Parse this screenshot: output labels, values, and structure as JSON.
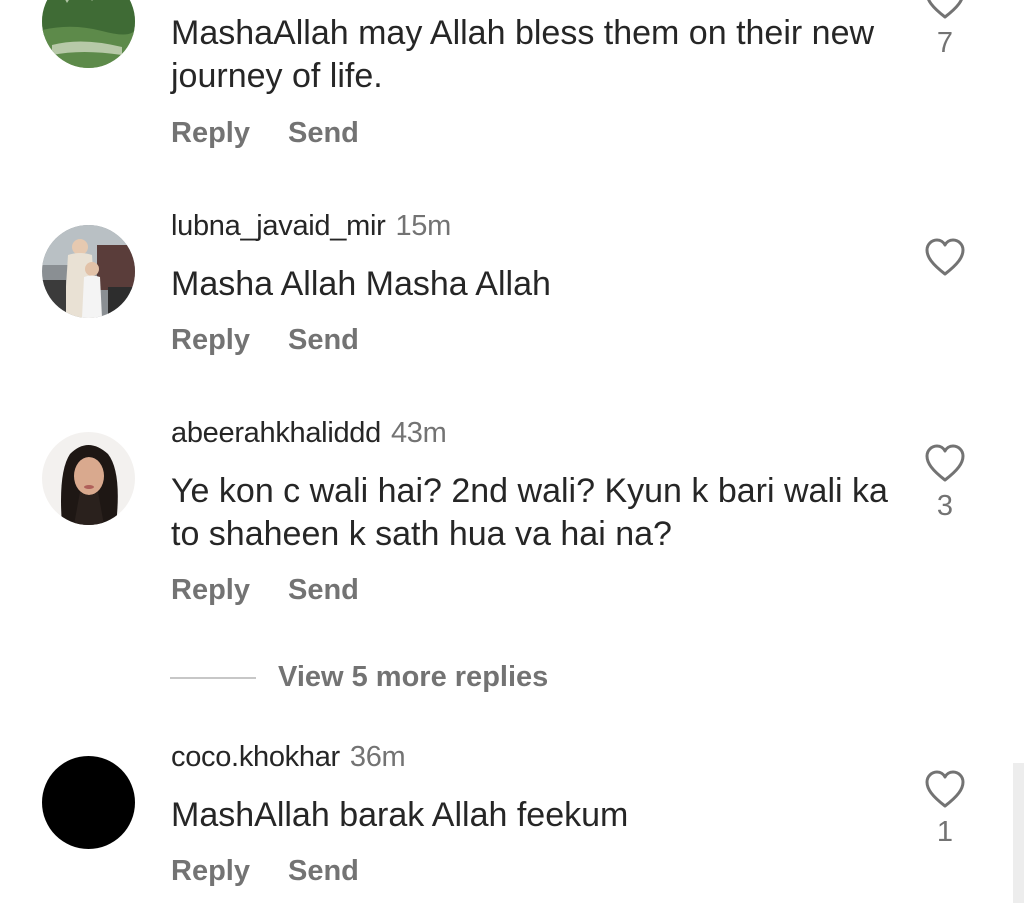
{
  "comments": [
    {
      "username": "",
      "time": "",
      "text": "MashaAllah may Allah bless them on their new journey of life.",
      "reply_label": "Reply",
      "send_label": "Send",
      "likes": "7"
    },
    {
      "username": "lubna_javaid_mir",
      "time": "15m",
      "text": "Masha Allah Masha Allah",
      "reply_label": "Reply",
      "send_label": "Send",
      "likes": ""
    },
    {
      "username": "abeerahkhaliddd",
      "time": "43m",
      "text": "Ye kon c wali hai? 2nd wali? Kyun k bari wali ka to shaheen k sath hua va hai na?",
      "reply_label": "Reply",
      "send_label": "Send",
      "likes": "3"
    },
    {
      "username": "coco.khokhar",
      "time": "36m",
      "text": "MashAllah barak Allah feekum",
      "reply_label": "Reply",
      "send_label": "Send",
      "likes": "1"
    }
  ],
  "view_more_replies": "View 5 more replies",
  "icons": {
    "like": "heart-outline-icon"
  },
  "colors": {
    "text": "#262626",
    "secondary": "#737373",
    "divider": "#c7c7c7"
  }
}
